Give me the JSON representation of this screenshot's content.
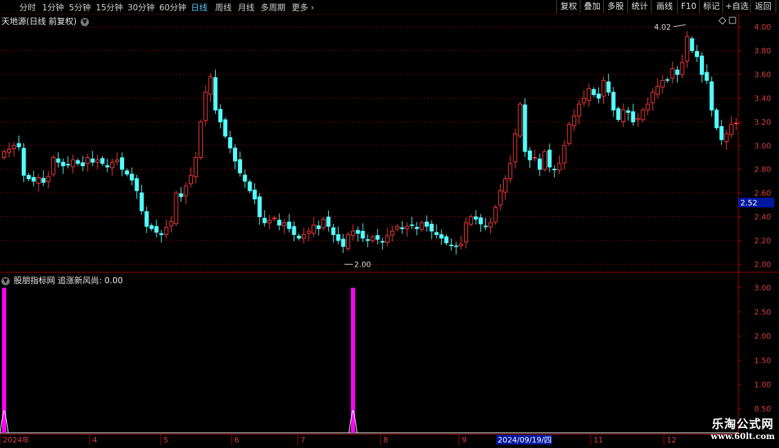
{
  "toolbar": {
    "periods": [
      "分时",
      "1分钟",
      "5分钟",
      "15分钟",
      "30分钟",
      "60分钟",
      "日线",
      "周线",
      "月线",
      "多周期",
      "更多"
    ],
    "active_period": "日线",
    "more_glyph": "›",
    "right_buttons": [
      "复权",
      "叠加",
      "多股",
      "统计",
      "画线",
      "F10",
      "标记",
      "+自选",
      "返回"
    ]
  },
  "main_chart": {
    "title": "天地源(日线 前复权)",
    "high_label": "4.02",
    "low_label": "2.00",
    "current_price": "2.52",
    "y_ticks": [
      "4.00",
      "3.80",
      "3.60",
      "3.40",
      "3.20",
      "3.00",
      "2.80",
      "2.60",
      "2.40",
      "2.20",
      "2.00"
    ]
  },
  "indicator": {
    "title": "股朋指标网 追涨新风尚: 0.00",
    "y_ticks": [
      "3.00",
      "2.50",
      "2.00",
      "1.50",
      "1.00",
      "0.50"
    ]
  },
  "time_axis": {
    "labels": [
      "2024年",
      "4",
      "5",
      "6",
      "7",
      "8",
      "9",
      "11",
      "12"
    ],
    "cursor_date": "2024/09/19/四"
  },
  "watermark": {
    "line1": "乐淘公式网",
    "line2": "www.60lt.com"
  },
  "colors": {
    "up": "#ff3b3b",
    "down": "#54ffff",
    "indicator": "#ff00ff",
    "grid": "#7a0000",
    "axis": "#b00000"
  },
  "chart_data": {
    "type": "candlestick",
    "series": [
      {
        "values": [
          2.95,
          2.97,
          3.0,
          2.99,
          2.75,
          2.72,
          2.7,
          2.73,
          2.69,
          2.74,
          2.9,
          2.86,
          2.83,
          2.84,
          2.88,
          2.85,
          2.83,
          2.9,
          2.86,
          2.88,
          2.85,
          2.82,
          2.86,
          2.88,
          2.8,
          2.76,
          2.71,
          2.62,
          2.45,
          2.32,
          2.3,
          2.27,
          2.25,
          2.31,
          2.36,
          2.6,
          2.57,
          2.66,
          2.75,
          2.9,
          3.2,
          3.45,
          3.58,
          3.3,
          3.2,
          3.08,
          2.98,
          2.87,
          2.77,
          2.7,
          2.62,
          2.55,
          2.4,
          2.35,
          2.37,
          2.39,
          2.33,
          2.35,
          2.3,
          2.25,
          2.22,
          2.25,
          2.28,
          2.33,
          2.3,
          2.38,
          2.32,
          2.25,
          2.2,
          2.15,
          2.25,
          2.28,
          2.26,
          2.22,
          2.2,
          2.23,
          2.21,
          2.19,
          2.24,
          2.28,
          2.32,
          2.3,
          2.32,
          2.33,
          2.3,
          2.35,
          2.32,
          2.28,
          2.25,
          2.22,
          2.18,
          2.16,
          2.15,
          2.17,
          2.35,
          2.4,
          2.38,
          2.34,
          2.32,
          2.35,
          2.48,
          2.62,
          2.72,
          2.85,
          3.1,
          3.35,
          2.95,
          2.88,
          2.9,
          2.8,
          2.95,
          2.82,
          2.8,
          2.85,
          3.0,
          3.18,
          3.25,
          3.35,
          3.4,
          3.48,
          3.43,
          3.4,
          3.55,
          3.45,
          3.3,
          3.22,
          3.3,
          3.28,
          3.2,
          3.23,
          3.3,
          3.35,
          3.45,
          3.5,
          3.55,
          3.55,
          3.65,
          3.6,
          3.7,
          3.92,
          3.8,
          3.75,
          3.6,
          3.55,
          3.3,
          3.15,
          3.05,
          3.1,
          3.18,
          3.19
        ]
      }
    ],
    "annotations": [
      "4.02",
      "2.00",
      "2.52"
    ],
    "ylim": [
      1.95,
      4.1
    ],
    "indicator_series": {
      "name": "追涨新风尚",
      "spikes": [
        {
          "index": 0,
          "value": 3.0
        },
        {
          "index": 71,
          "value": 3.0
        }
      ],
      "ylim": [
        0,
        3.25
      ]
    }
  }
}
